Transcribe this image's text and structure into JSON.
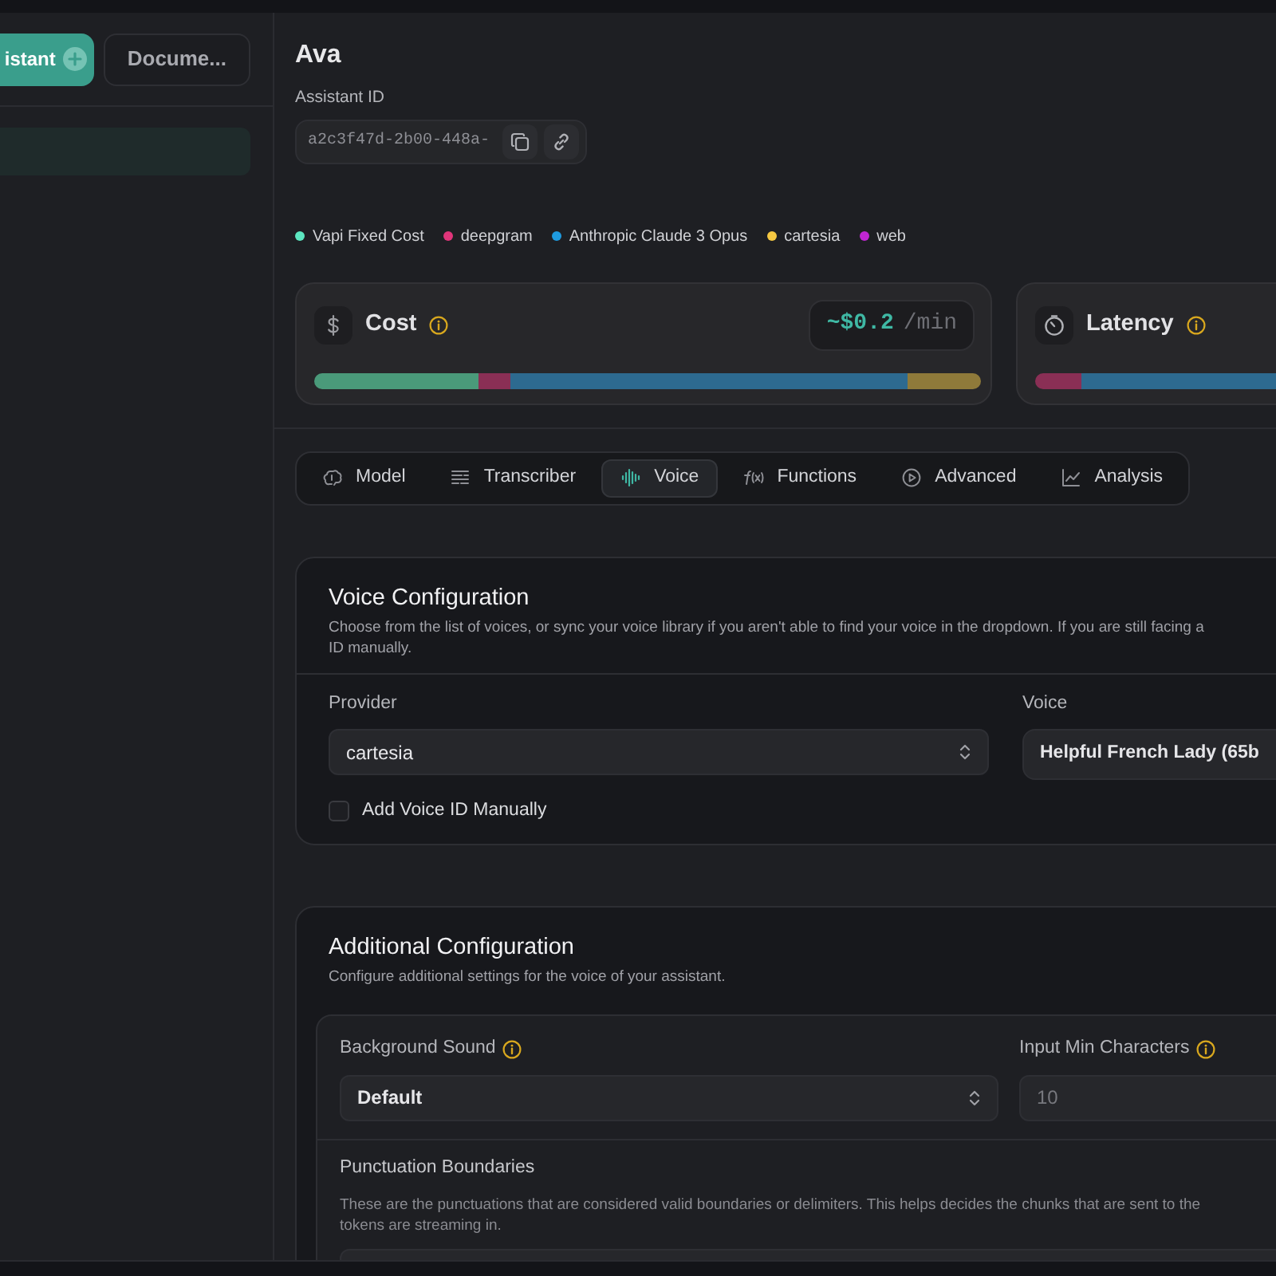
{
  "sidebar": {
    "buttons": [
      {
        "label": "istant",
        "kind": "primary"
      },
      {
        "label": "Docume...",
        "kind": "secondary"
      }
    ]
  },
  "assistant": {
    "name": "Ava",
    "id_label": "Assistant ID",
    "id_value": "a2c3f47d-2b00-448a-"
  },
  "legend": [
    {
      "label": "Vapi Fixed Cost",
      "color": "#5ce6c0"
    },
    {
      "label": "deepgram",
      "color": "#e0357a"
    },
    {
      "label": "Anthropic Claude 3 Opus",
      "color": "#1e9be0"
    },
    {
      "label": "cartesia",
      "color": "#f5c842"
    },
    {
      "label": "web",
      "color": "#c026d3"
    }
  ],
  "metrics": [
    {
      "kind": "cost",
      "title": "Cost",
      "price": "~$0.2",
      "unit": "/min"
    },
    {
      "kind": "latency",
      "title": "Latency"
    }
  ],
  "tabs": [
    {
      "label": "Model",
      "selected": false
    },
    {
      "label": "Transcriber",
      "selected": false
    },
    {
      "label": "Voice",
      "selected": true
    },
    {
      "label": "Functions",
      "selected": false
    },
    {
      "label": "Advanced",
      "selected": false
    },
    {
      "label": "Analysis",
      "selected": false
    }
  ],
  "voice_configuration": {
    "title": "Voice Configuration",
    "description_lines": [
      "Choose from the list of voices, or sync your voice library if you aren't able to find your voice in the dropdown. If you are still facing a",
      "ID manually."
    ],
    "fields": [
      {
        "label": "Provider",
        "kind": "select",
        "value": "cartesia",
        "bold": false
      },
      {
        "label": "Voice",
        "kind": "plain",
        "value": "Helpful French Lady (65b",
        "bold": true
      }
    ],
    "checkbox": {
      "label": "Add Voice ID Manually",
      "checked": false
    }
  },
  "additional_configuration": {
    "title": "Additional Configuration",
    "description": "Configure additional settings for the voice of your assistant.",
    "fields": [
      {
        "label": "Background Sound",
        "info": true,
        "kind": "select",
        "value": "Default",
        "bold": true
      },
      {
        "label": "Input Min Characters",
        "info": true,
        "kind": "input",
        "placeholder": "10"
      }
    ],
    "punctuation": {
      "title": "Punctuation Boundaries",
      "description_lines": [
        "These are the punctuations that are considered valid boundaries or delimiters. This helps decides the chunks that are sent to the",
        "tokens are streaming in."
      ]
    }
  }
}
